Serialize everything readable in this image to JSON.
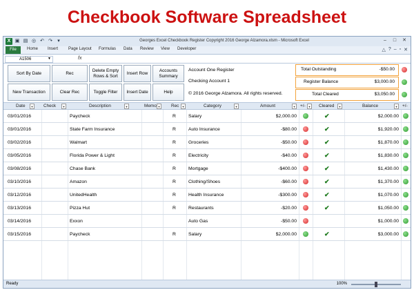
{
  "banner": {
    "title": "Checkbook Software Spreadsheet"
  },
  "window": {
    "title": "Georges Excel Checkbook Register Copyright 2016 George Alzamora.xlsm - Microsoft Excel"
  },
  "ribbon": {
    "tabs": [
      "File",
      "Home",
      "Insert",
      "Page Layout",
      "Formulas",
      "Data",
      "Review",
      "View",
      "Developer"
    ]
  },
  "formula_bar": {
    "name_box": "A1506",
    "fx": "fx"
  },
  "controls": {
    "buttons": {
      "sort_by_date": "Sort By Date",
      "rec": "Rec",
      "delete_empty": "Delete Empty Rows & Sort",
      "insert_row": "Insert Row",
      "accounts_summary": "Accounts Summary",
      "new_transaction": "New Transaction",
      "clear_rec": "Clear Rec",
      "toggle_filter": "Toggle Filter",
      "insert_date": "Insert Date",
      "help": "Help"
    },
    "info": {
      "register": "Account One Register",
      "account": "Checking Account 1",
      "copyright": "© 2016 George Alzamora.  All rights reserved."
    }
  },
  "summary": {
    "total_outstanding": {
      "label": "Total Outstanding",
      "value": "-$50.00",
      "status": "red"
    },
    "register_balance": {
      "label": "Register Balance",
      "value": "$3,000.00",
      "status": "green"
    },
    "total_cleared": {
      "label": "Total Cleared",
      "value": "$3,050.00",
      "status": "green"
    }
  },
  "columns": {
    "date": "Date",
    "check": "Check",
    "description": "Description",
    "memo": "Memo",
    "rec": "Rec",
    "category": "Category",
    "amount": "Amount",
    "plusminus": "+/-",
    "cleared": "Cleared",
    "balance": "Balance",
    "plusminus2": "+/-"
  },
  "rows": [
    {
      "date": "03/01/2016",
      "description": "Paycheck",
      "rec": "R",
      "category": "Salary",
      "amount": "$2,000.00",
      "status": "green",
      "cleared": true,
      "balance": "$2,000.00",
      "bstatus": "green"
    },
    {
      "date": "03/01/2016",
      "description": "State Farm Insurance",
      "rec": "R",
      "category": "Auto Insurance",
      "amount": "-$80.00",
      "status": "red",
      "cleared": true,
      "balance": "$1,920.00",
      "bstatus": "green"
    },
    {
      "date": "03/02/2016",
      "description": "Walmart",
      "rec": "R",
      "category": "Groceries",
      "amount": "-$50.00",
      "status": "red",
      "cleared": true,
      "balance": "$1,870.00",
      "bstatus": "green"
    },
    {
      "date": "03/05/2016",
      "description": "Florida Power & Light",
      "rec": "R",
      "category": "Electricity",
      "amount": "-$40.00",
      "status": "red",
      "cleared": true,
      "balance": "$1,830.00",
      "bstatus": "green"
    },
    {
      "date": "03/08/2016",
      "description": "Chase Bank",
      "rec": "R",
      "category": "Mortgage",
      "amount": "-$400.00",
      "status": "red",
      "cleared": true,
      "balance": "$1,430.00",
      "bstatus": "green"
    },
    {
      "date": "03/10/2016",
      "description": "Amazon",
      "rec": "R",
      "category": "Clothing/Shoes",
      "amount": "-$60.00",
      "status": "red",
      "cleared": true,
      "balance": "$1,370.00",
      "bstatus": "green"
    },
    {
      "date": "03/12/2016",
      "description": "UnitedHealth",
      "rec": "R",
      "category": "Health Insurance",
      "amount": "-$300.00",
      "status": "red",
      "cleared": true,
      "balance": "$1,070.00",
      "bstatus": "green"
    },
    {
      "date": "03/13/2016",
      "description": "Pizza Hut",
      "rec": "R",
      "category": "Restaurants",
      "amount": "-$20.00",
      "status": "red",
      "cleared": true,
      "balance": "$1,050.00",
      "bstatus": "green"
    },
    {
      "date": "03/14/2016",
      "description": "Exxon",
      "rec": "",
      "category": "Auto Gas",
      "amount": "-$50.00",
      "status": "red",
      "cleared": false,
      "balance": "$1,000.00",
      "bstatus": "green"
    },
    {
      "date": "03/15/2016",
      "description": "Paycheck",
      "rec": "R",
      "category": "Salary",
      "amount": "$2,000.00",
      "status": "green",
      "cleared": true,
      "balance": "$3,000.00",
      "bstatus": "green"
    }
  ],
  "status_bar": {
    "ready": "Ready",
    "zoom": "100%"
  }
}
